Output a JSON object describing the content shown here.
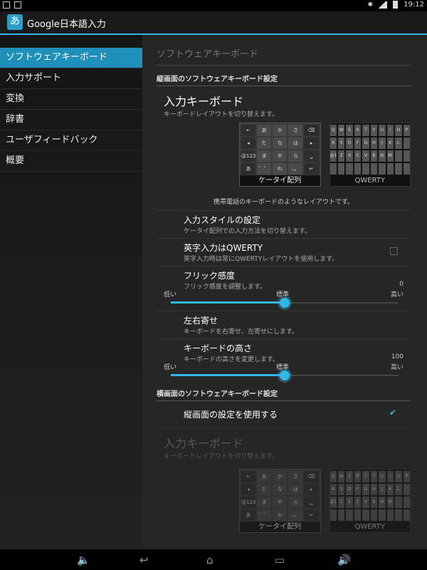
{
  "status_bar": {
    "time": "19:12"
  },
  "app": {
    "title": "Google日本語入力",
    "icon_char": "あ"
  },
  "sidebar": {
    "items": [
      {
        "label": "ソフトウェアキーボード",
        "active": true
      },
      {
        "label": "入力サポート",
        "active": false
      },
      {
        "label": "変換",
        "active": false
      },
      {
        "label": "辞書",
        "active": false
      },
      {
        "label": "ユーザフィードバック",
        "active": false
      },
      {
        "label": "概要",
        "active": false
      }
    ]
  },
  "content": {
    "page_heading": "ソフトウェアキーボード",
    "portrait": {
      "category": "縦画面のソフトウェアキーボード設定",
      "keyboard": {
        "title": "入力キーボード",
        "subtitle": "キーボードレイアウトを切り替えます。",
        "options": [
          "ケータイ配列",
          "QWERTY"
        ],
        "selected": "ケータイ配列",
        "description": "携帯電話のキーボードのようなレイアウトです。"
      },
      "input_style": {
        "title": "入力スタイルの設定",
        "subtitle": "ケータイ配列での入力方法を切り替えます。"
      },
      "qwerty_english": {
        "title": "英字入力はQWERTY",
        "subtitle": "英字入力時は常にQWERTYレイアウトを使用します。",
        "checked": false
      },
      "flick": {
        "title": "フリック感度",
        "subtitle": "フリック感度を調整します。",
        "value": "0",
        "low": "低い",
        "mid": "標準",
        "high": "高い",
        "level": 0.5
      },
      "alignment": {
        "title": "左右寄せ",
        "subtitle": "キーボードを右寄せ、左寄せにします。"
      },
      "height": {
        "title": "キーボードの高さ",
        "subtitle": "キーボードの高さを変更します。",
        "value": "100",
        "low": "低い",
        "mid": "標準",
        "high": "高い",
        "level": 0.5
      }
    },
    "landscape": {
      "category": "横画面のソフトウェアキーボード設定",
      "use_portrait": {
        "title": "縦画面の設定を使用する",
        "checked": true
      },
      "keyboard": {
        "title": "入力キーボード",
        "subtitle": "キーボードレイアウトを切り替えます。",
        "options": [
          "ケータイ配列",
          "QWERTY"
        ]
      }
    }
  },
  "keypad_keys": [
    "←",
    "あ",
    "か",
    "さ",
    "⌫",
    "◂",
    "た",
    "な",
    "は",
    "▸",
    "@123",
    "ま",
    "や",
    "ら",
    "␣",
    "あ",
    "゛゜",
    "わ",
    "、。",
    "↵"
  ],
  "qwerty_keys": [
    "Q",
    "W",
    "E",
    "R",
    "T",
    "Y",
    "U",
    "I",
    "O",
    "P",
    "A",
    "S",
    "D",
    "F",
    "G",
    "H",
    "J",
    "K",
    "L",
    "",
    "@123",
    "Z",
    "X",
    "C",
    "V",
    "B",
    "N",
    "M",
    "",
    ""
  ],
  "colors": {
    "accent": "#33b5e5",
    "sidebar_active": "#1e8fb8"
  }
}
